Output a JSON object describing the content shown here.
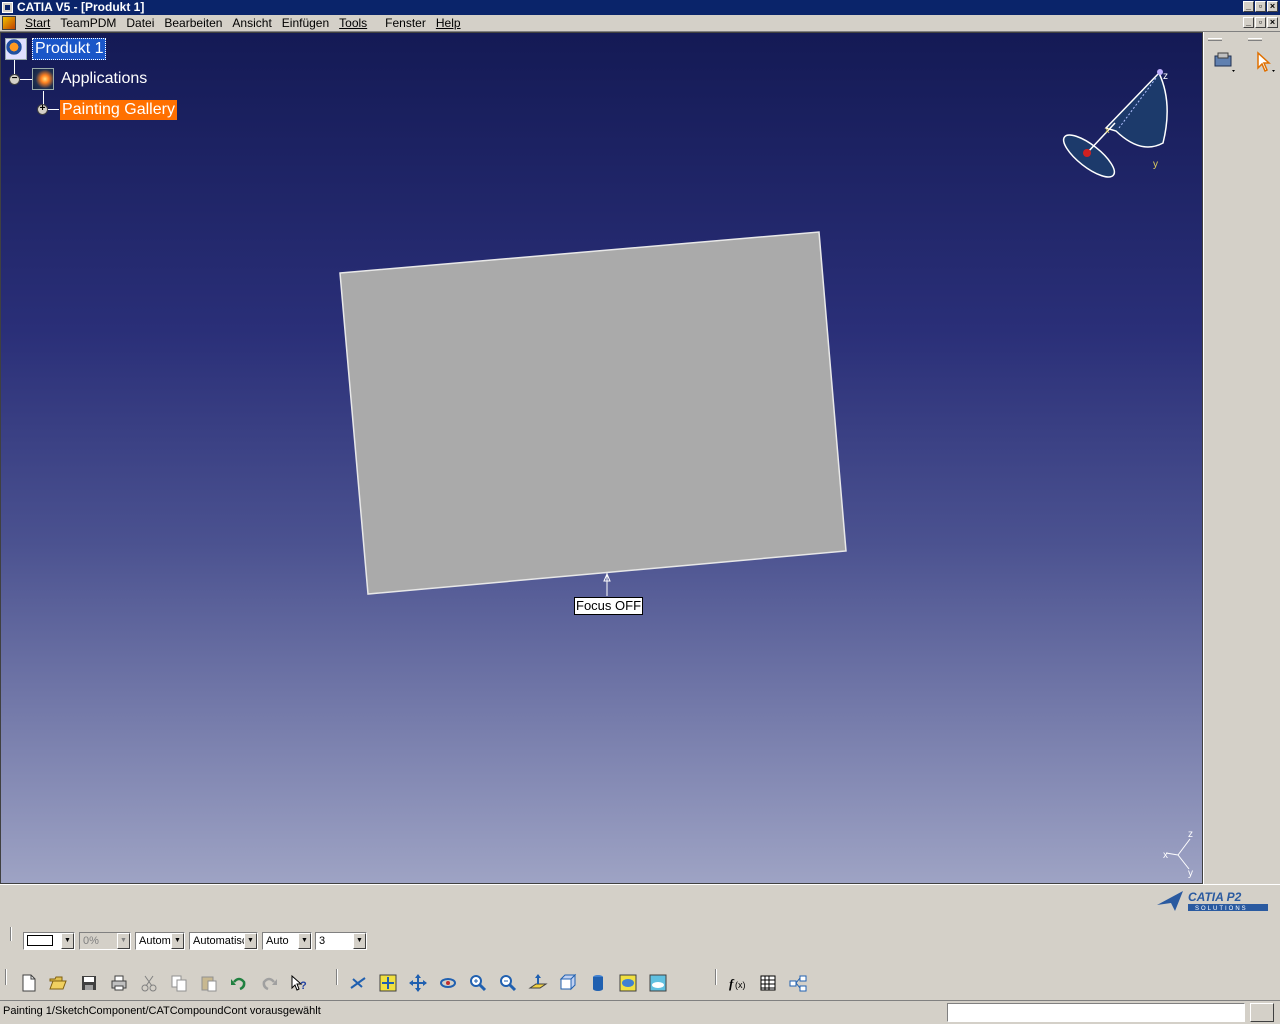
{
  "window": {
    "title": "CATIA V5 - [Produkt 1]"
  },
  "menu": {
    "items": [
      "Start",
      "TeamPDM",
      "Datei",
      "Bearbeiten",
      "Ansicht",
      "Einfügen",
      "Tools",
      "Fenster",
      "Help"
    ]
  },
  "tree": {
    "root": "Produkt 1",
    "child": "Applications",
    "grandchild": "Painting Gallery"
  },
  "viewport": {
    "focus_label": "Focus OFF",
    "compass_z": "z",
    "compass_y": "y",
    "compass_x": "x",
    "axis_z": "z",
    "axis_x": "x",
    "axis_y": "y"
  },
  "logo": {
    "name": "CATIA P2",
    "sub": "SOLUTIONS"
  },
  "graphic_props": {
    "color": "",
    "transparency": "0%",
    "line_weight": "Autom",
    "line_type": "Automatisc",
    "point_type": "Auto",
    "layer": "3"
  },
  "standard_tools": [
    "new-icon",
    "open-icon",
    "save-icon",
    "print-icon",
    "cut-icon",
    "copy-icon",
    "paste-icon",
    "undo-icon",
    "redo-icon",
    "whats-this-icon"
  ],
  "view_tools": [
    "fly-mode-icon",
    "fit-all-icon",
    "pan-icon",
    "rotate-icon",
    "zoom-in-icon",
    "zoom-out-icon",
    "normal-view-icon",
    "quick-view-icon",
    "view-mode-icon",
    "hide-show-icon",
    "swap-visible-icon"
  ],
  "knowledge_tools": [
    "formula-icon",
    "table-icon",
    "parameters-icon"
  ],
  "status": {
    "text": "Painting 1/SketchComponent/CATCompoundCont vorausgewählt"
  },
  "colors": {
    "viewport_top": "#141a55",
    "viewport_bottom": "#9ea3c4",
    "selection": "#1a56c8",
    "highlight": "#ff7000",
    "sheet": "#aaaaaa"
  }
}
